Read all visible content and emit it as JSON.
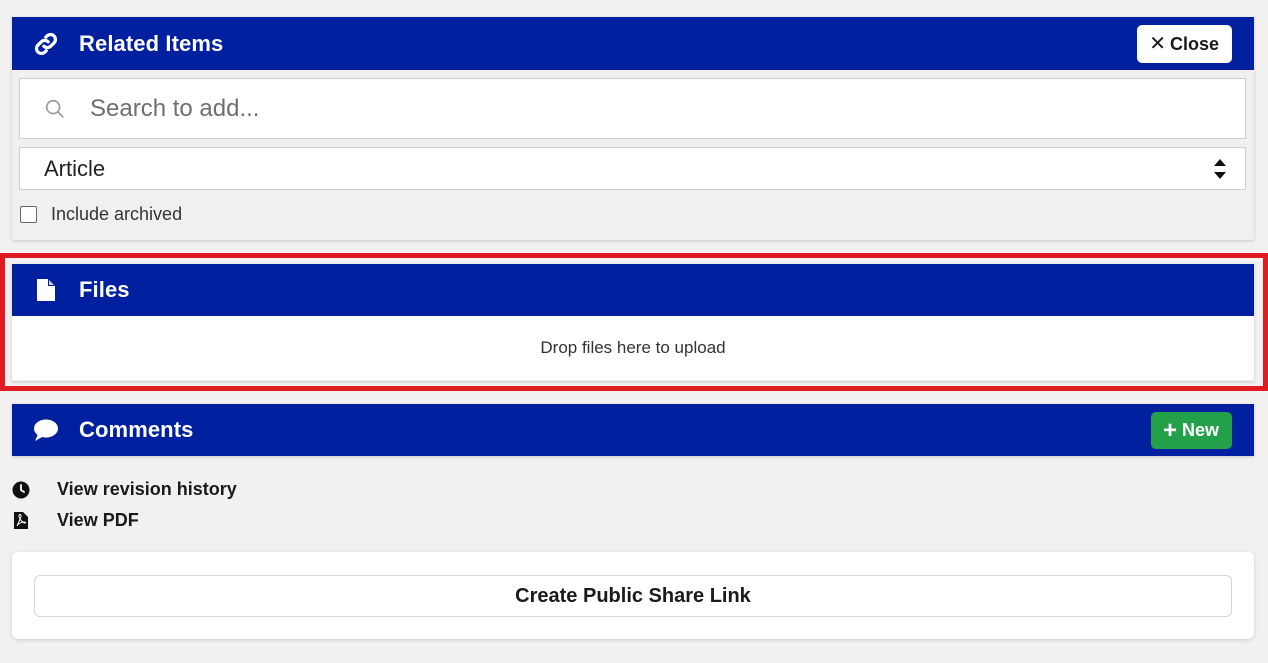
{
  "related_items": {
    "title": "Related Items",
    "icon": "link-icon",
    "close_label": "Close",
    "search_placeholder": "Search to add...",
    "type_select_value": "Article",
    "include_archived_label": "Include archived",
    "include_archived_checked": false
  },
  "files": {
    "title": "Files",
    "icon": "file-icon",
    "drop_text": "Drop files here to upload"
  },
  "comments": {
    "title": "Comments",
    "icon": "comment-icon",
    "new_label": "New"
  },
  "links": {
    "revision_history": "View revision history",
    "view_pdf": "View PDF"
  },
  "share": {
    "button_label": "Create Public Share Link"
  },
  "colors": {
    "header_bg": "#0020a0",
    "new_button": "#22a14a",
    "highlight": "#e01b22",
    "page_bg": "#f2f1f0"
  }
}
